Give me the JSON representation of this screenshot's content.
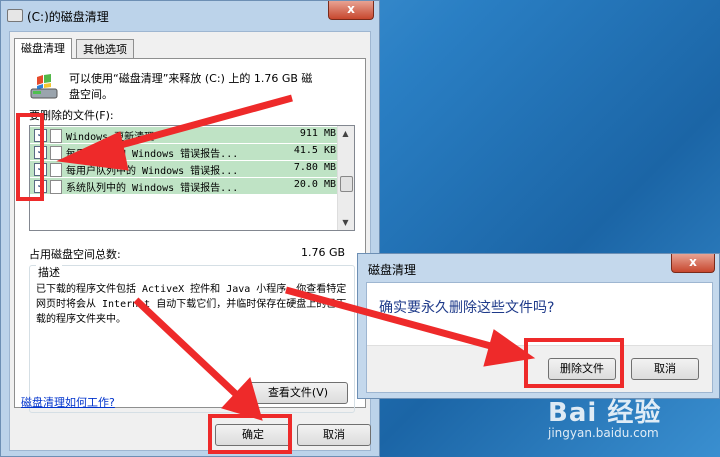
{
  "main_window": {
    "title": "(C:)的磁盘清理",
    "close_glyph": "x",
    "tabs": [
      "磁盘清理",
      "其他选项"
    ],
    "intro_line1": "可以使用“磁盘清理”来释放  (C:) 上的 1.76 GB 磁",
    "intro_line2": "盘空间。",
    "files_label": "要删除的文件(F):",
    "files": [
      {
        "name": "Windows 更新清理",
        "size": "911 MB",
        "checked": true
      },
      {
        "name": "每用户存档的 Windows 错误报告...",
        "size": "41.5 KB",
        "checked": true
      },
      {
        "name": "每用户队列中的 Windows 错误报...",
        "size": "7.80 MB",
        "checked": true
      },
      {
        "name": "系统队列中的 Windows 错误报告...",
        "size": "20.0 MB",
        "checked": true
      }
    ],
    "total_label": "占用磁盘空间总数:",
    "total_value": "1.76 GB",
    "description_title": "描述",
    "description_text": "已下载的程序文件包括 ActiveX 控件和 Java 小程序，你查看特定网页时将会从 Internet 自动下载它们，并临时保存在硬盘上的已下载的程序文件夹中。",
    "view_files_button": "查看文件(V)",
    "help_link": "磁盘清理如何工作?",
    "ok_button": "确定",
    "cancel_button": "取消"
  },
  "confirm_dialog": {
    "title": "磁盘清理",
    "close_glyph": "x",
    "question": "确实要永久删除这些文件吗?",
    "delete_button": "删除文件",
    "cancel_button": "取消"
  },
  "watermark": {
    "logo": "Bai 经验",
    "url": "jingyan.baidu.com"
  },
  "colors": {
    "annotation_red": "#ee2a2a",
    "selected_row_green": "#bfe3c5",
    "link_blue": "#0033cc",
    "close_red": "#c7472e"
  }
}
